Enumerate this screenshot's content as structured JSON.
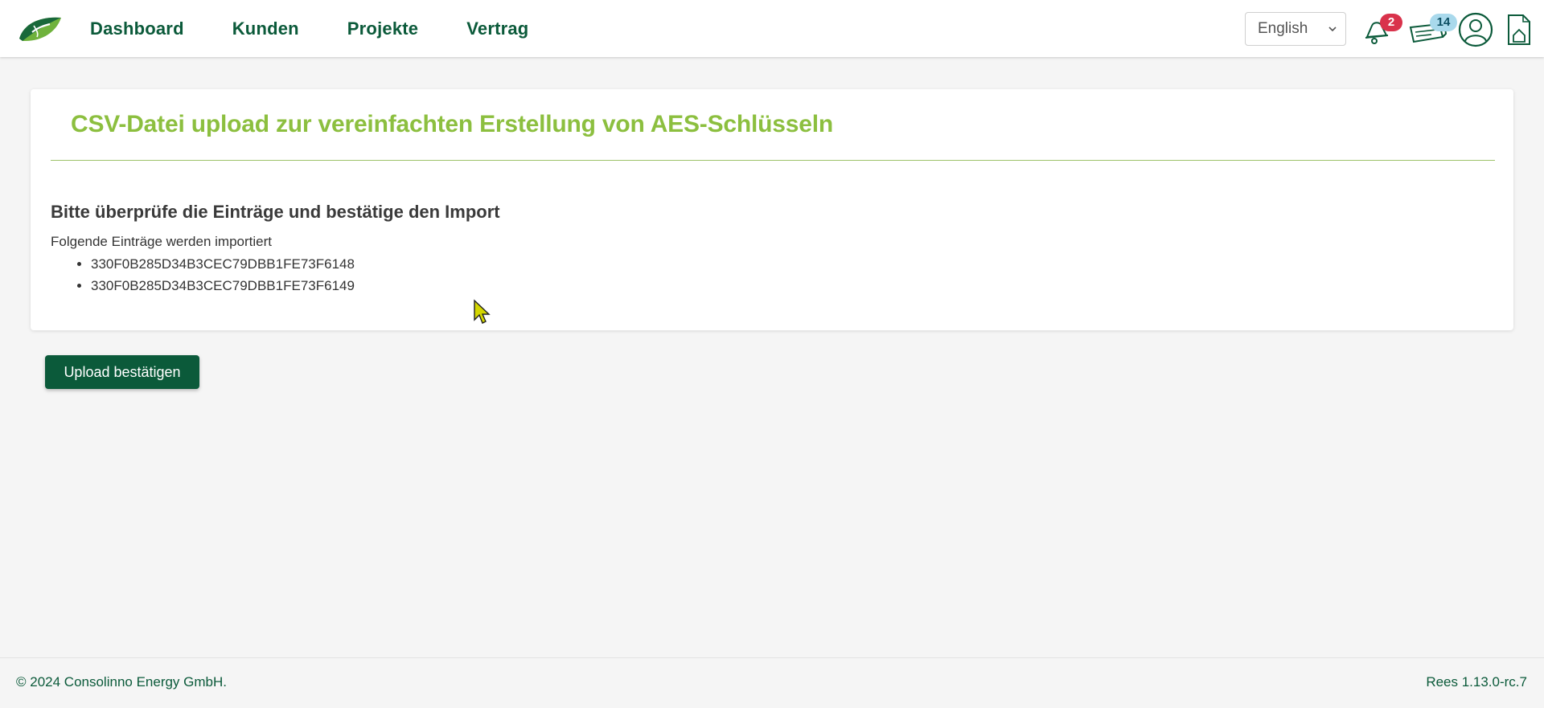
{
  "progress_fraction": 0.743,
  "header": {
    "nav": [
      {
        "label": "Dashboard"
      },
      {
        "label": "Kunden"
      },
      {
        "label": "Projekte"
      },
      {
        "label": "Vertrag"
      }
    ],
    "language": "English",
    "notifications_count": "2",
    "news_count": "14",
    "icons": {
      "logo": "leaf-logo",
      "notifications": "bell-icon",
      "news": "news-icon",
      "profile": "user-icon",
      "home": "house-document-icon"
    }
  },
  "card": {
    "title": "CSV-Datei upload zur vereinfachten Erstellung von AES-Schlüsseln",
    "review_heading": "Bitte überprüfe die Einträge und bestätige den Import",
    "entries_label": "Folgende Einträge werden importiert",
    "entries": [
      "330F0B285D34B3CEC79DBB1FE73F6148",
      "330F0B285D34B3CEC79DBB1FE73F6149"
    ]
  },
  "actions": {
    "confirm_label": "Upload bestätigen"
  },
  "footer": {
    "copyright": "© 2024 Consolinno Energy GmbH.",
    "version": "Rees 1.13.0-rc.7"
  },
  "colors": {
    "brand_green": "#0b5a3a",
    "title_green": "#8cbf3f",
    "progress_blue": "#3a93c8",
    "badge_red": "#d9324b",
    "badge_blue": "#a9d9ec"
  }
}
